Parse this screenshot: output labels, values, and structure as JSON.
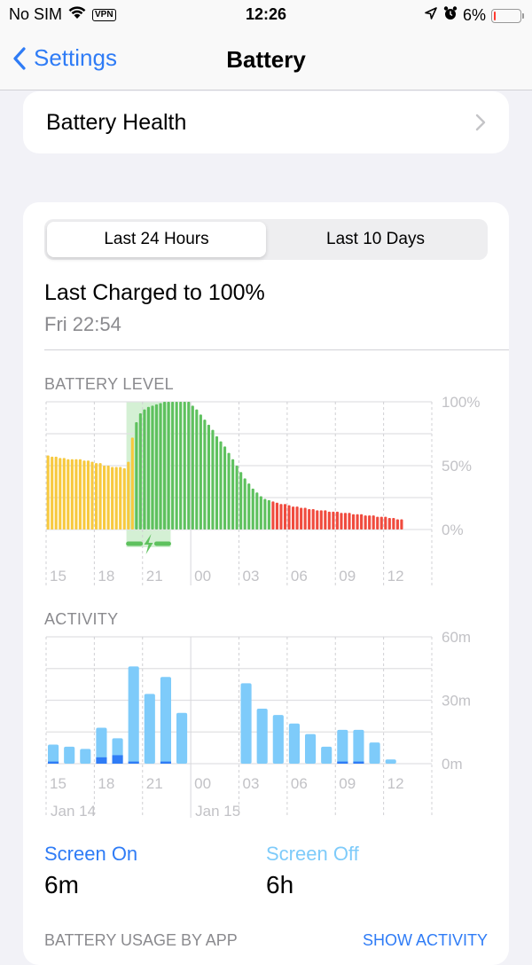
{
  "status_bar": {
    "carrier": "No SIM",
    "vpn_label": "VPN",
    "time": "12:26",
    "battery_percent": "6%",
    "battery_level": 0.06,
    "icons": [
      "wifi-icon",
      "vpn-icon",
      "location-icon",
      "alarm-icon",
      "battery-icon"
    ]
  },
  "nav": {
    "back_label": "Settings",
    "title": "Battery"
  },
  "battery_health": {
    "label": "Battery Health"
  },
  "segmented": {
    "options": [
      "Last 24 Hours",
      "Last 10 Days"
    ],
    "selected": 0
  },
  "last_charged": {
    "title": "Last Charged to 100%",
    "time": "Fri 22:54"
  },
  "colors": {
    "accent": "#2f7cf6",
    "yellow": "#f7c93e",
    "green": "#5ec15e",
    "red": "#f04b3e",
    "charging_band": "#d4f0d4",
    "screen_on": "#2f7cf6",
    "screen_off": "#7ecbfa",
    "grid": "#e0e0e3",
    "axis_text": "#c2c2c6"
  },
  "chart_data": [
    {
      "type": "bar",
      "title": "BATTERY LEVEL",
      "xlabel": "",
      "ylabel": "",
      "x_tick_labels": [
        "15",
        "18",
        "21",
        "00",
        "03",
        "06",
        "09",
        "12"
      ],
      "y_tick_labels": [
        "100%",
        "50%",
        "0%"
      ],
      "ylim": [
        0,
        100
      ],
      "interval_minutes": 15,
      "total_slots": 96,
      "grid": true,
      "charging_period_slots": [
        20,
        31
      ],
      "series": [
        {
          "name": "battery_level",
          "color_rule": "yellow=low-power, green=normal, red=low battery",
          "values": [
            58,
            57,
            57,
            56,
            56,
            55,
            55,
            55,
            55,
            54,
            54,
            53,
            52,
            52,
            50,
            50,
            49,
            49,
            49,
            48,
            53,
            72,
            84,
            91,
            94,
            96,
            97,
            98,
            99,
            100,
            100,
            100,
            100,
            100,
            100,
            100,
            97,
            94,
            90,
            86,
            82,
            78,
            73,
            69,
            65,
            60,
            55,
            50,
            45,
            40,
            36,
            32,
            29,
            26,
            24,
            23,
            22,
            21,
            20,
            20,
            19,
            18,
            18,
            17,
            17,
            16,
            16,
            15,
            15,
            15,
            14,
            14,
            14,
            13,
            13,
            13,
            12,
            12,
            12,
            11,
            11,
            11,
            10,
            10,
            10,
            9,
            9,
            8,
            8
          ],
          "colors": [
            "yellow",
            "yellow",
            "yellow",
            "yellow",
            "yellow",
            "yellow",
            "yellow",
            "yellow",
            "yellow",
            "yellow",
            "yellow",
            "yellow",
            "yellow",
            "yellow",
            "yellow",
            "yellow",
            "yellow",
            "yellow",
            "yellow",
            "yellow",
            "yellow",
            "yellow",
            "green",
            "green",
            "green",
            "green",
            "green",
            "green",
            "green",
            "green",
            "green",
            "green",
            "green",
            "green",
            "green",
            "green",
            "green",
            "green",
            "green",
            "green",
            "green",
            "green",
            "green",
            "green",
            "green",
            "green",
            "green",
            "green",
            "green",
            "green",
            "green",
            "green",
            "green",
            "green",
            "green",
            "green",
            "red",
            "red",
            "red",
            "red",
            "red",
            "red",
            "red",
            "red",
            "red",
            "red",
            "red",
            "red",
            "red",
            "red",
            "red",
            "red",
            "red",
            "red",
            "red",
            "red",
            "red",
            "red",
            "red",
            "red",
            "red",
            "red",
            "red",
            "red",
            "red",
            "red",
            "red",
            "red",
            "red"
          ]
        }
      ]
    },
    {
      "type": "bar",
      "title": "ACTIVITY",
      "xlabel": "",
      "ylabel": "",
      "x_tick_labels": [
        "15",
        "18",
        "21",
        "00",
        "03",
        "06",
        "09",
        "12"
      ],
      "date_labels": [
        "Jan 14",
        "Jan 15"
      ],
      "y_tick_labels": [
        "60m",
        "30m",
        "0m"
      ],
      "ylim": [
        0,
        60
      ],
      "interval_minutes": 60,
      "grid": true,
      "series": [
        {
          "name": "Screen On",
          "values": [
            1,
            0,
            0,
            3,
            4,
            1,
            0,
            1,
            0,
            0,
            0,
            0,
            0,
            0,
            0,
            0,
            0,
            0,
            1,
            1,
            0,
            0
          ]
        },
        {
          "name": "Screen Off",
          "values": [
            8,
            8,
            7,
            14,
            8,
            45,
            33,
            40,
            24,
            0,
            0,
            0,
            38,
            26,
            23,
            19,
            14,
            8,
            15,
            15,
            10,
            2
          ]
        }
      ]
    }
  ],
  "summary": {
    "screen_on_label": "Screen On",
    "screen_on_value": "6m",
    "screen_off_label": "Screen Off",
    "screen_off_value": "6h"
  },
  "footer": {
    "usage_label": "BATTERY USAGE BY APP",
    "show_activity_label": "SHOW ACTIVITY"
  }
}
